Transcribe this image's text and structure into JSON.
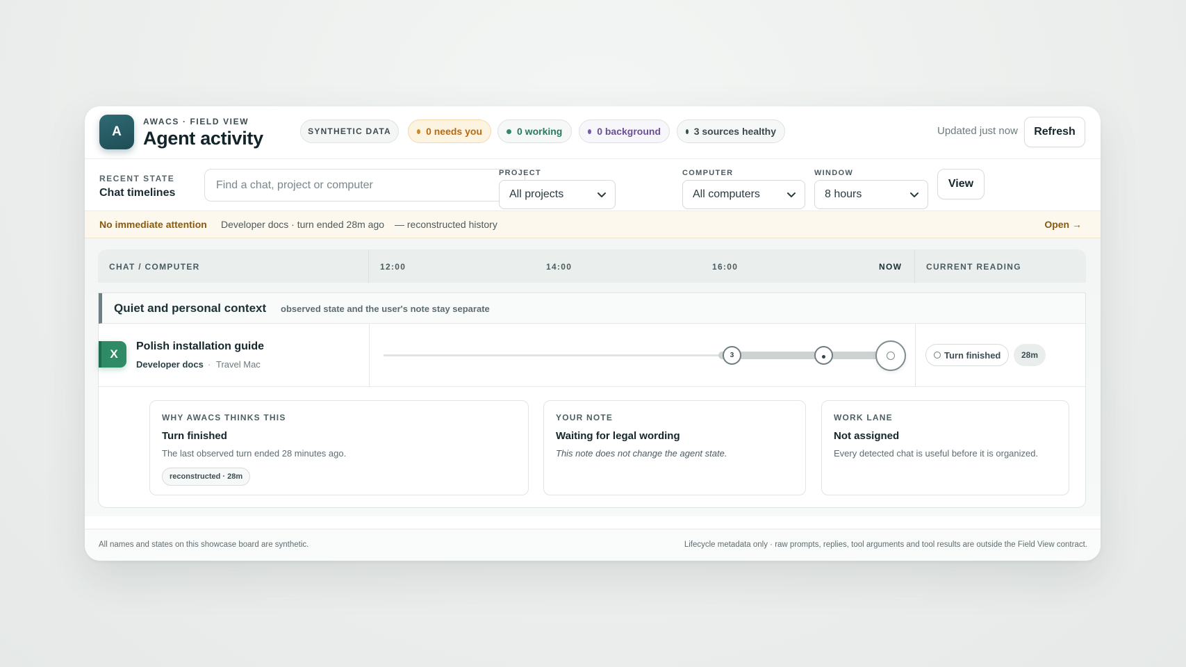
{
  "header": {
    "logo_letter": "A",
    "eyebrow": "AWACS · FIELD VIEW",
    "title": "Agent activity",
    "synthetic_badge": "SYNTHETIC DATA",
    "status_pills": {
      "needs_you": "0 needs you",
      "working": "0 working",
      "background": "0 background",
      "sources": "3 sources healthy"
    },
    "updated": "Updated just now",
    "refresh_label": "Refresh"
  },
  "filters": {
    "eyebrow": "RECENT STATE",
    "title": "Chat timelines",
    "search_placeholder": "Find a chat, project or computer",
    "project_label": "PROJECT",
    "project_value": "All projects",
    "computer_label": "COMPUTER",
    "computer_value": "All computers",
    "window_label": "WINDOW",
    "window_value": "8 hours",
    "view_label": "View"
  },
  "banner": {
    "title": "No immediate attention",
    "detail": "Developer docs · turn ended 28m ago",
    "reconstructed": "— reconstructed history",
    "open_label": "Open →"
  },
  "timeline": {
    "col_chat": "CHAT / COMPUTER",
    "ticks": [
      "12:00",
      "14:00",
      "16:00",
      "NOW"
    ],
    "col_reading": "CURRENT READING",
    "group": {
      "title": "Quiet and personal context",
      "subtitle": "observed state and the user's note stay separate"
    },
    "chat": {
      "icon_letter": "X",
      "title": "Polish installation guide",
      "project": "Developer docs",
      "separator": "·",
      "computer": "Travel Mac",
      "marker_count": "3",
      "reading": "Turn finished",
      "age": "28m"
    }
  },
  "panels": {
    "why": {
      "eyebrow": "WHY AWACS THINKS THIS",
      "title": "Turn finished",
      "text": "The last observed turn ended 28 minutes ago.",
      "tag": "reconstructed · 28m"
    },
    "note": {
      "eyebrow": "YOUR NOTE",
      "title": "Waiting for legal wording",
      "text": "This note does not change the agent state."
    },
    "lane": {
      "eyebrow": "WORK LANE",
      "title": "Not assigned",
      "text": "Every detected chat is useful before it is organized."
    }
  },
  "footer": {
    "left": "All names and states on this showcase board are synthetic.",
    "right": "Lifecycle metadata only · raw prompts, replies, tool arguments and tool results are outside the Field View contract."
  },
  "colors": {
    "accent": "#1f4c55",
    "needs_you": "#b86a10",
    "working": "#257c5c",
    "background": "#6a4e96",
    "chat_icon": "#2f8a66"
  }
}
